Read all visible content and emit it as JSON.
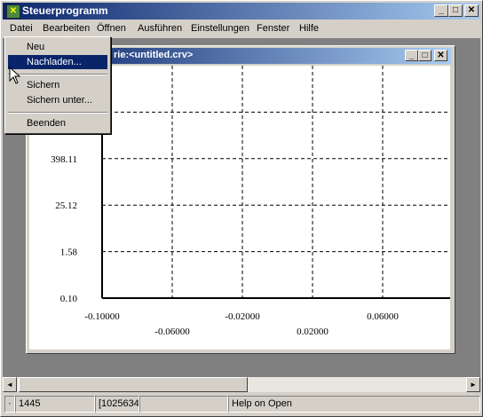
{
  "app": {
    "title": "Steuerprogramm"
  },
  "caption_buttons": {
    "minimize": "_",
    "maximize": "□",
    "close": "✕"
  },
  "menubar": [
    {
      "label": "Datei"
    },
    {
      "label": "Bearbeiten"
    },
    {
      "label": "Öffnen"
    },
    {
      "label": "Ausführen"
    },
    {
      "label": "Einstellungen"
    },
    {
      "label": "Fenster"
    },
    {
      "label": "Hilfe"
    }
  ],
  "file_menu": {
    "items": [
      {
        "label": "Neu"
      },
      {
        "label": "Nachladen..."
      },
      {
        "label": "Sichern"
      },
      {
        "label": "Sichern unter..."
      },
      {
        "label": "Beenden"
      }
    ],
    "selected": "Nachladen..."
  },
  "child_window": {
    "title": "rie:<untitled.crv>"
  },
  "chart_data": {
    "type": "line",
    "y_tick_labels": [
      "398.11",
      "25.12",
      "1.58",
      "0.10"
    ],
    "x_tick_labels_upper": [
      "-0.10000",
      "-0.02000",
      "0.06000"
    ],
    "x_tick_labels_lower": [
      "-0.06000",
      "0.02000"
    ],
    "y_scale": "log",
    "grid": true,
    "series": []
  },
  "scrollbar": {
    "left": "◄",
    "right": "►"
  },
  "statusbar": {
    "pane1": "·",
    "pane2": "1445",
    "pane3": "[1025634",
    "pane4": "",
    "help": "Help on Open"
  },
  "colors": {
    "titlebar_start": "#0a246a",
    "titlebar_end": "#a6caf0",
    "selection": "#0a246a",
    "client_bg": "#808080"
  }
}
